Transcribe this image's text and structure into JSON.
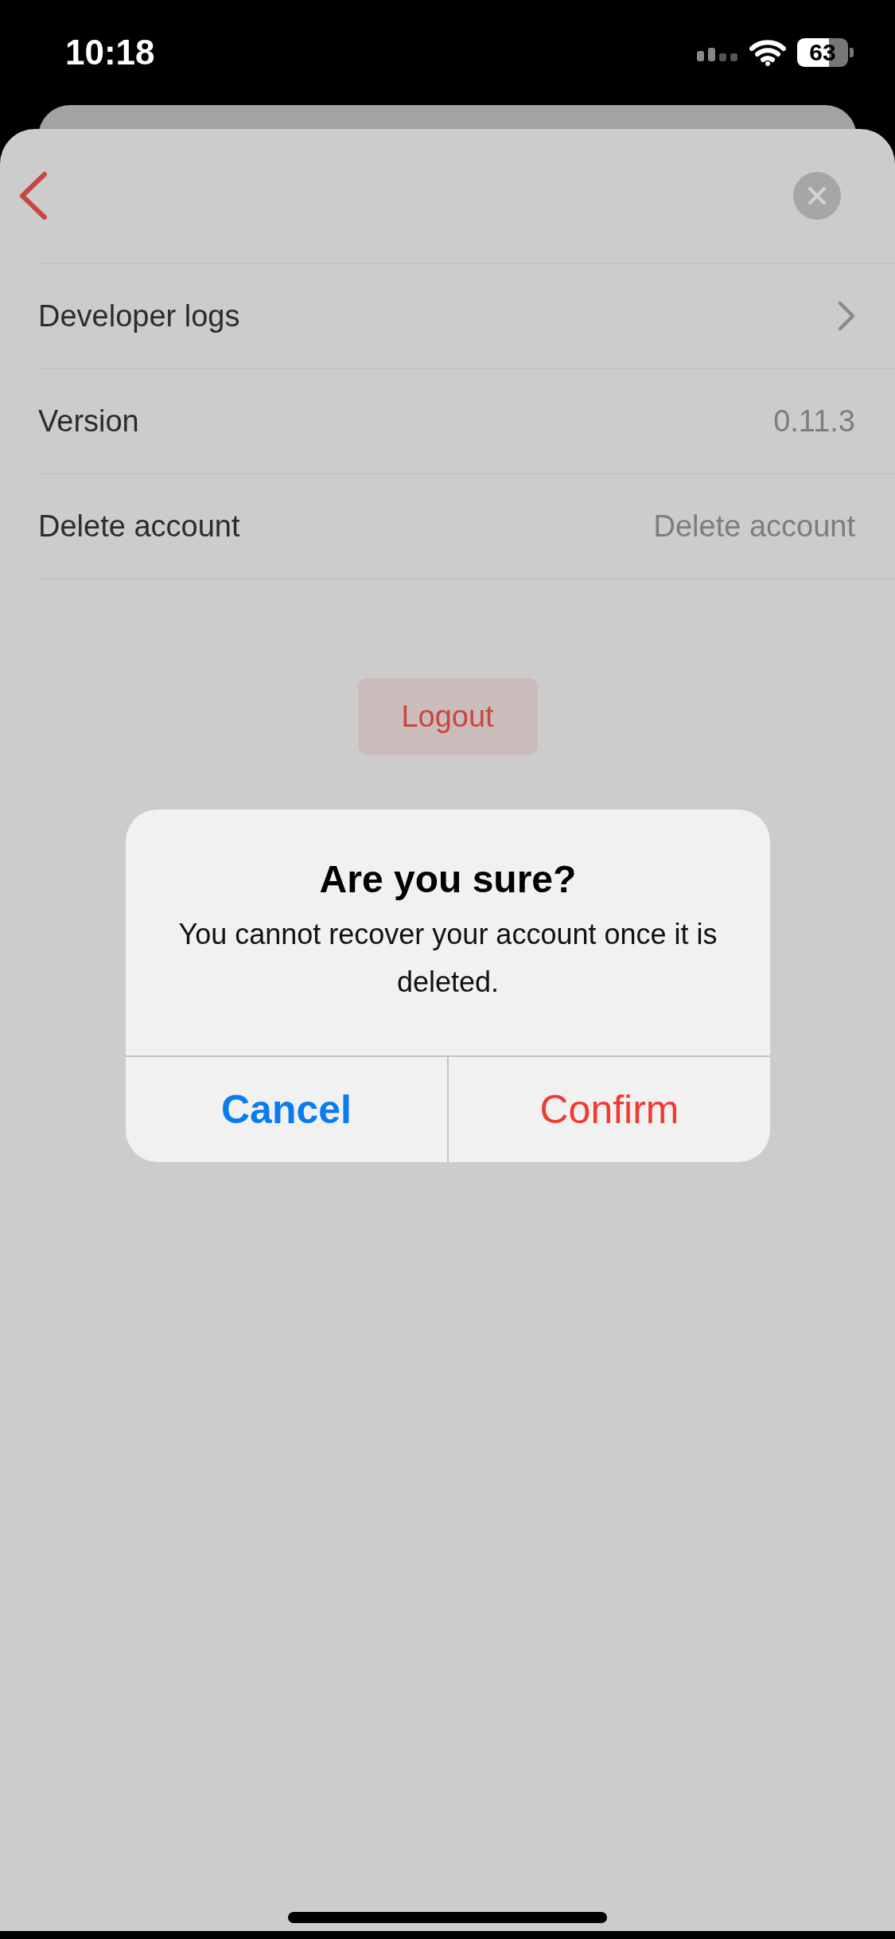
{
  "status_bar": {
    "time": "10:18",
    "battery": "63"
  },
  "rows": [
    {
      "label": "Developer logs",
      "kind": "chevron"
    },
    {
      "label": "Version",
      "kind": "value",
      "value": "0.11.3"
    },
    {
      "label": "Delete account",
      "kind": "value",
      "value": "Delete account"
    }
  ],
  "logout_button": "Logout",
  "dialog": {
    "title": "Are you sure?",
    "message": "You cannot recover your account once it is deleted.",
    "buttons": [
      {
        "label": "Cancel",
        "kind": "cancel"
      },
      {
        "label": "Confirm",
        "kind": "destructive"
      }
    ]
  }
}
